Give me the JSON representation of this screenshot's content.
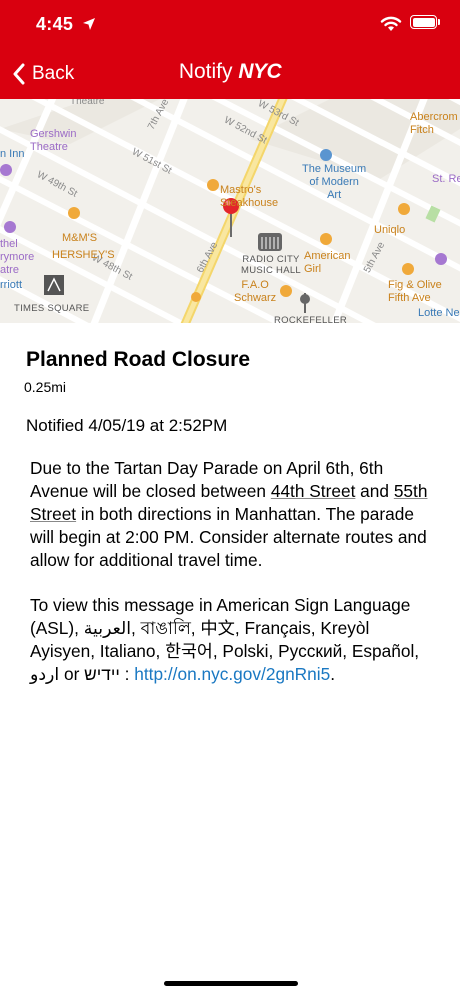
{
  "status_bar": {
    "time": "4:45"
  },
  "nav": {
    "back_label": "Back",
    "title_part1": "Notify ",
    "title_part2": "NYC"
  },
  "map": {
    "streets": [
      "W 53rd St",
      "W 52nd St",
      "W 51st St",
      "W 49th St",
      "W 48th St",
      "6th Ave",
      "5th Ave",
      "7th Ave"
    ],
    "pois": {
      "theatre_top": "Theatre",
      "gershwin": "Gershwin\nTheatre",
      "inn": "n Inn",
      "mastros": "Mastro's\nSteakhouse",
      "moma": "The Museum\nof Modern\nArt",
      "abercrombie": "Abercrom\nFitch",
      "st_re": "St. Re",
      "mms": "M&M'S",
      "hersheys": "HERSHEY'S",
      "ethel": "thel\nrymore\natre",
      "radio_city": "RADIO CITY\nMUSIC HALL",
      "american_girl": "American\nGirl",
      "uniqlo": "Uniqlo",
      "fao": "F.A.O\nSchwarz",
      "fig_olive": "Fig & Olive\nFifth Ave",
      "rriott": "rriott",
      "times_square": "TIMES SQUARE",
      "rockefeller": "ROCKEFELLER",
      "lotte": "Lotte Ne"
    }
  },
  "alert": {
    "title": "Planned Road Closure",
    "distance": "0.25mi",
    "notified": "Notified 4/05/19 at 2:52PM",
    "p1_a": "Due to the Tartan Day Parade on April 6th, 6th Avenue will be closed between ",
    "p1_street1": "44th Street",
    "p1_b": " and ",
    "p1_street2": "55th Street",
    "p1_c": " in both directions in Manhattan. The parade will begin at 2:00 PM. Consider alternate routes and allow for additional travel time.",
    "p2_a": "To view this message in American Sign Language (ASL), العربية, বাঙালি, 中文, Français, Kreyòl Ayisyen, Italiano, 한국어, Polski, Русский, Español, اردو or יידיש : ",
    "p2_link": "http://on.nyc.gov/2gnRni5",
    "p2_end": "."
  },
  "colors": {
    "header": "#d9000f",
    "link": "#1a78c2",
    "pin": "#e3242b"
  }
}
